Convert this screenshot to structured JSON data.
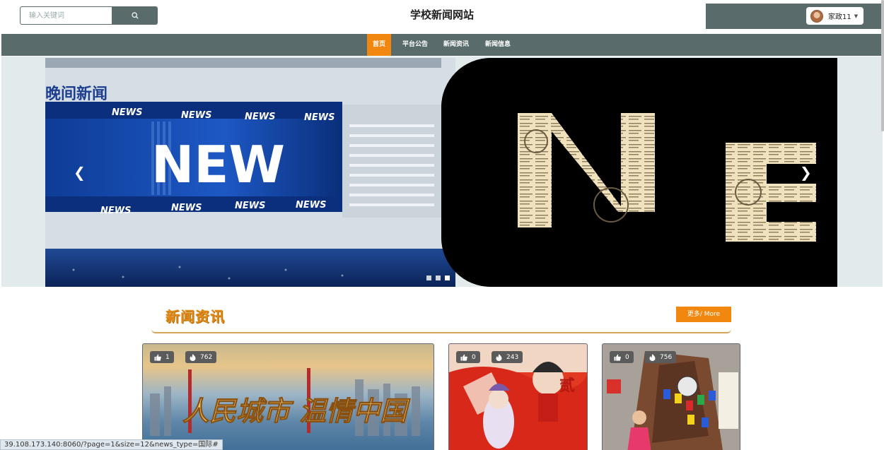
{
  "header": {
    "title": "学校新闻网站",
    "search_placeholder": "输入关键词",
    "user_name": "家政11"
  },
  "nav": {
    "items": [
      "首页",
      "平台公告",
      "新闻资讯",
      "新闻信息"
    ],
    "active_index": 0
  },
  "banner": {
    "slide_left": {
      "headline": "晚间新闻",
      "ticker_word": "NEWS",
      "big_word": "NEW"
    },
    "slide_right": {
      "big_letters": [
        "N",
        "E"
      ]
    },
    "dot_count": 3,
    "active_dot": 2
  },
  "section": {
    "title": "新闻资讯",
    "more_label": "更多/ More"
  },
  "cards": [
    {
      "likes": "1",
      "views": "762",
      "caption": "人民城市 温情中国"
    },
    {
      "likes": "0",
      "views": "243",
      "caption": "贰"
    },
    {
      "likes": "0",
      "views": "756",
      "caption": ""
    }
  ],
  "status_url": "39.108.173.140:8060/?page=1&size=12&news_type=国际#",
  "colors": {
    "nav_bg": "#5a6b6b",
    "accent": "#f2870f"
  }
}
